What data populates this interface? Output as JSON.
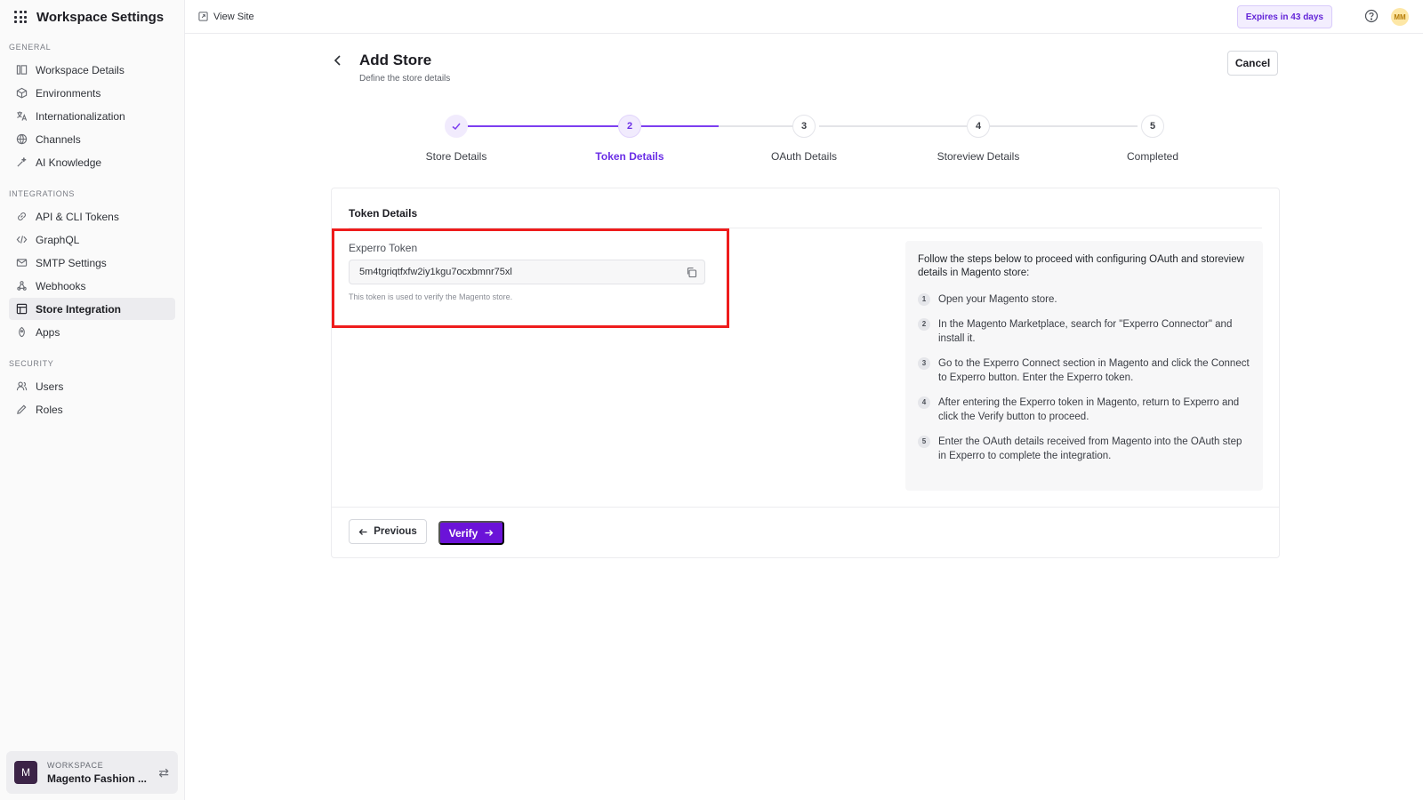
{
  "sidebar": {
    "title": "Workspace Settings",
    "sections": {
      "general": "GENERAL",
      "integrations": "INTEGRATIONS",
      "security": "SECURITY"
    },
    "items": {
      "workspace_details": "Workspace Details",
      "environments": "Environments",
      "internationalization": "Internationalization",
      "channels": "Channels",
      "ai_knowledge": "AI Knowledge",
      "api_cli_tokens": "API & CLI Tokens",
      "graphql": "GraphQL",
      "smtp_settings": "SMTP Settings",
      "webhooks": "Webhooks",
      "store_integration": "Store Integration",
      "apps": "Apps",
      "users": "Users",
      "roles": "Roles"
    },
    "active_item": "Store Integration",
    "workspace": {
      "label": "WORKSPACE",
      "name": "Magento Fashion ...",
      "avatar_letter": "M"
    }
  },
  "topbar": {
    "view_site": "View Site",
    "expires": "Expires in 43 days",
    "user_initials": "MM"
  },
  "page": {
    "title": "Add Store",
    "subtitle": "Define the store details",
    "cancel": "Cancel"
  },
  "stepper": {
    "steps": [
      {
        "number": "1",
        "label": "Store Details",
        "status": "done"
      },
      {
        "number": "2",
        "label": "Token Details",
        "status": "current"
      },
      {
        "number": "3",
        "label": "OAuth Details",
        "status": "pending"
      },
      {
        "number": "4",
        "label": "Storeview Details",
        "status": "pending"
      },
      {
        "number": "5",
        "label": "Completed",
        "status": "pending"
      }
    ]
  },
  "card": {
    "title": "Token Details",
    "token_field": {
      "label": "Experro Token",
      "value": "5m4tgriqtfxfw2iy1kgu7ocxbmnr75xl",
      "hint": "This token is used to verify the Magento store."
    },
    "instructions": {
      "intro": "Follow the steps below to proceed with configuring OAuth and storeview details in Magento store:",
      "steps": [
        {
          "n": "1",
          "text": "Open your Magento store."
        },
        {
          "n": "2",
          "text": "In the Magento Marketplace, search for \"Experro Connector\" and install it."
        },
        {
          "n": "3",
          "text": "Go to the Experro Connect section in Magento and click the Connect to Experro button. Enter the Experro token."
        },
        {
          "n": "4",
          "text": "After entering the Experro token in Magento, return to Experro and click the Verify button to proceed."
        },
        {
          "n": "5",
          "text": "Enter the OAuth details received from Magento into the OAuth step in Experro to complete the integration."
        }
      ]
    },
    "previous": "Previous",
    "verify": "Verify"
  },
  "colors": {
    "accent": "#6b13d8",
    "highlight_border": "#ee1c1c",
    "badge_bg": "#f3eefe"
  }
}
